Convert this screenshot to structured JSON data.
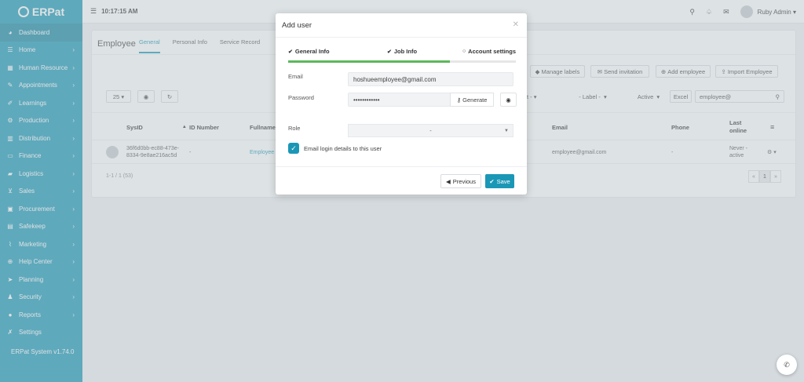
{
  "app": {
    "logo_text": "ERPat",
    "version": "ERPat System v1.74.0"
  },
  "topbar": {
    "time": "10:17:15 AM",
    "user_name": "Ruby Admin ▾"
  },
  "sidebar": {
    "items": [
      {
        "label": "Dashboard",
        "icon": "dashboard-icon",
        "glyph": "◕",
        "chevron": ""
      },
      {
        "label": "Home",
        "icon": "home-icon",
        "glyph": "☰",
        "chevron": "›"
      },
      {
        "label": "Human Resource",
        "icon": "human-resource-icon",
        "glyph": "▦",
        "chevron": "›"
      },
      {
        "label": "Appointments",
        "icon": "appointments-icon",
        "glyph": "✎",
        "chevron": "›"
      },
      {
        "label": "Learnings",
        "icon": "learnings-icon",
        "glyph": "✐",
        "chevron": "›"
      },
      {
        "label": "Production",
        "icon": "production-icon",
        "glyph": "⚙",
        "chevron": "›"
      },
      {
        "label": "Distribution",
        "icon": "distribution-icon",
        "glyph": "▥",
        "chevron": "›"
      },
      {
        "label": "Finance",
        "icon": "finance-icon",
        "glyph": "▭",
        "chevron": "›"
      },
      {
        "label": "Logistics",
        "icon": "logistics-icon",
        "glyph": "▰",
        "chevron": "›"
      },
      {
        "label": "Sales",
        "icon": "sales-icon",
        "glyph": "⊻",
        "chevron": "›"
      },
      {
        "label": "Procurement",
        "icon": "procurement-icon",
        "glyph": "▣",
        "chevron": "›"
      },
      {
        "label": "Safekeep",
        "icon": "safekeep-icon",
        "glyph": "▤",
        "chevron": "›"
      },
      {
        "label": "Marketing",
        "icon": "marketing-icon",
        "glyph": "⌇",
        "chevron": "›"
      },
      {
        "label": "Help Center",
        "icon": "help-center-icon",
        "glyph": "⊕",
        "chevron": "›"
      },
      {
        "label": "Planning",
        "icon": "planning-icon",
        "glyph": "➤",
        "chevron": "›"
      },
      {
        "label": "Security",
        "icon": "security-icon",
        "glyph": "♟",
        "chevron": "›"
      },
      {
        "label": "Reports",
        "icon": "reports-icon",
        "glyph": "●",
        "chevron": "›"
      },
      {
        "label": "Settings",
        "icon": "settings-icon",
        "glyph": "✗",
        "chevron": ""
      }
    ]
  },
  "page": {
    "title": "Employee",
    "tabs": [
      "General",
      "Personal Info",
      "Service Record"
    ],
    "toolbar": {
      "manage_labels": "Manage labels",
      "send_invitation": "Send invitation",
      "add_employee": "Add employee",
      "import_employee": "Import Employee"
    },
    "filters": {
      "page_size": "25",
      "label": "- Label -",
      "status": "Active",
      "excel": "Excel",
      "search_value": "employee@",
      "partial_dropdown": "t -"
    },
    "table": {
      "headers": [
        "SysID",
        "ID Number",
        "Fullname",
        "Email",
        "Phone",
        "Last online"
      ],
      "row": {
        "sysid": "36f6d0bb-ec88-473e-8334-9e8ae216ac5d",
        "id_number": "-",
        "fullname": "Employee",
        "email": "employee@gmail.com",
        "phone": "-",
        "last_online": "Never - active"
      }
    },
    "pager_info": "1-1 / 1 (53)",
    "pager_current": "1"
  },
  "modal": {
    "title": "Add user",
    "steps": [
      "General Info",
      "Job Info",
      "Account settings"
    ],
    "progress_fraction": 0.71,
    "email_label": "Email",
    "email_value": "hoshueemployee@gmail.com",
    "password_label": "Password",
    "password_value": "••••••••••••",
    "generate_label": "Generate",
    "role_label": "Role",
    "role_value": "-",
    "checkbox_label": "Email login details to this user",
    "previous_label": "Previous",
    "save_label": "Save"
  },
  "colors": {
    "accent": "#1b97b6",
    "progress": "#5cb85c"
  }
}
